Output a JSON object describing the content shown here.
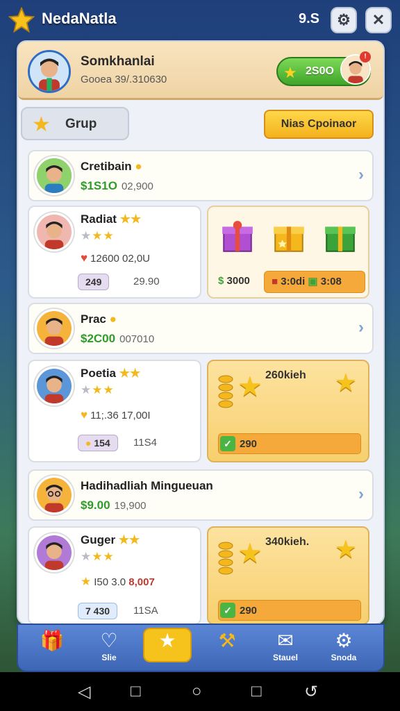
{
  "topbar": {
    "title": "NedaNatla",
    "clock": "9.S",
    "settings_icon": "settings-icon",
    "close_label": "✕"
  },
  "header": {
    "name": "Somkhanlai",
    "sub": "Gooea 39/.310630",
    "coins": "2S0O",
    "badge": "!"
  },
  "tabs": {
    "group_label": "Grup",
    "action_button": "Nias Cpoinaor"
  },
  "rows": [
    {
      "name": "Cretibain",
      "money": "$1S1O",
      "money_sub": "02,900"
    },
    {
      "name": "Prac",
      "money": "$2C00",
      "money_sub": "007010"
    },
    {
      "name": "Hadihadliah Mingueuan",
      "money": "$9.00",
      "money_sub": "19,900"
    }
  ],
  "cards": [
    {
      "name": "Radiat",
      "line2": "12600 02,0U",
      "tag": "249",
      "tag_sub": "29.90"
    },
    {
      "name": "Poetia",
      "line2": "11;.36 17,00I",
      "tag": "154",
      "tag_sub": "11S4"
    },
    {
      "name": "Guger",
      "line2": "I50 3.0",
      "line2_red": "8,007",
      "tag": "7 430",
      "tag_sub": "11SA"
    }
  ],
  "gifts": {
    "pill1": "3000",
    "pill2": "3:0di",
    "pill3": "3:08"
  },
  "rewards": [
    {
      "label": "260kieh",
      "bar": "290"
    },
    {
      "label": "340kieh.",
      "bar": "290"
    }
  ],
  "nav": {
    "item2": "Slie",
    "item5": "Stauel",
    "item6": "Snoda"
  },
  "colors": {
    "accent_green": "#2e9b2a",
    "gold": "#f6c21c",
    "nav_blue": "#3d66b5"
  }
}
